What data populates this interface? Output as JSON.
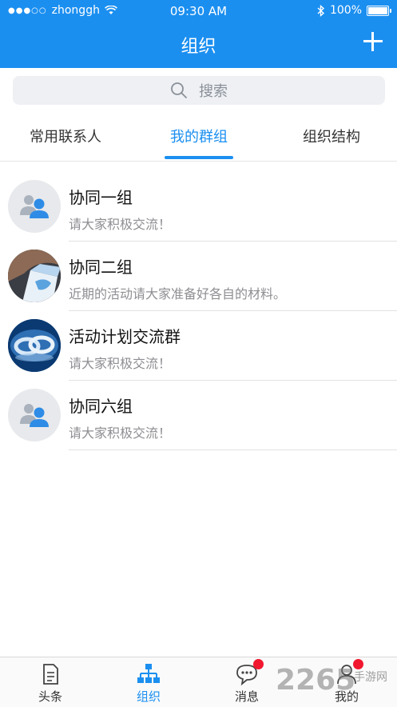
{
  "status_bar": {
    "carrier": "zhonggh",
    "time": "09:30 AM",
    "battery": "100%"
  },
  "header": {
    "title": "组织"
  },
  "search": {
    "placeholder": "搜索"
  },
  "tabs": [
    {
      "label": "常用联系人",
      "active": false
    },
    {
      "label": "我的群组",
      "active": true
    },
    {
      "label": "组织结构",
      "active": false
    }
  ],
  "groups": [
    {
      "name": "协同一组",
      "message": "请大家积极交流！",
      "avatar": "people-icon"
    },
    {
      "name": "协同二组",
      "message": "近期的活动请大家准备好各自的材料。",
      "avatar": "photo"
    },
    {
      "name": "活动计划交流群",
      "message": "请大家积极交流！",
      "avatar": "photo"
    },
    {
      "name": "协同六组",
      "message": "请大家积极交流！",
      "avatar": "people-icon"
    }
  ],
  "tabbar": [
    {
      "label": "头条",
      "icon": "document-icon",
      "active": false
    },
    {
      "label": "组织",
      "icon": "org-chart-icon",
      "active": true
    },
    {
      "label": "消息",
      "icon": "chat-icon",
      "active": false,
      "badge": true
    },
    {
      "label": "我的",
      "icon": "person-icon",
      "active": false,
      "badge": true
    }
  ],
  "watermark": {
    "text": "2265",
    "sub": "手游网"
  },
  "colors": {
    "primary": "#1b8ff0",
    "badge": "#f1172f"
  }
}
